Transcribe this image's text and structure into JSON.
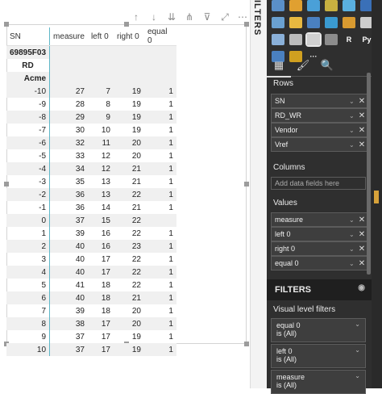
{
  "toolbar_icons": [
    "arrow-up-icon",
    "arrow-down-icon",
    "double-arrow-down-icon",
    "expand-hierarchy-icon",
    "filter-icon",
    "focus-mode-icon",
    "more-options-icon"
  ],
  "matrix": {
    "headers": [
      "SN",
      "measure",
      "left 0",
      "right 0",
      "equal 0"
    ],
    "hierarchy": [
      "69895F03",
      "RD",
      "Acme"
    ],
    "rows": [
      {
        "sn": "-10",
        "measure": "27",
        "left": "7",
        "right": "19",
        "equal": "1"
      },
      {
        "sn": "-9",
        "measure": "28",
        "left": "8",
        "right": "19",
        "equal": "1"
      },
      {
        "sn": "-8",
        "measure": "29",
        "left": "9",
        "right": "19",
        "equal": "1"
      },
      {
        "sn": "-7",
        "measure": "30",
        "left": "10",
        "right": "19",
        "equal": "1"
      },
      {
        "sn": "-6",
        "measure": "32",
        "left": "11",
        "right": "20",
        "equal": "1"
      },
      {
        "sn": "-5",
        "measure": "33",
        "left": "12",
        "right": "20",
        "equal": "1"
      },
      {
        "sn": "-4",
        "measure": "34",
        "left": "12",
        "right": "21",
        "equal": "1"
      },
      {
        "sn": "-3",
        "measure": "35",
        "left": "13",
        "right": "21",
        "equal": "1"
      },
      {
        "sn": "-2",
        "measure": "36",
        "left": "13",
        "right": "22",
        "equal": "1"
      },
      {
        "sn": "-1",
        "measure": "36",
        "left": "14",
        "right": "21",
        "equal": "1"
      },
      {
        "sn": "0",
        "measure": "37",
        "left": "15",
        "right": "22",
        "equal": ""
      },
      {
        "sn": "1",
        "measure": "39",
        "left": "16",
        "right": "22",
        "equal": "1"
      },
      {
        "sn": "2",
        "measure": "40",
        "left": "16",
        "right": "23",
        "equal": "1"
      },
      {
        "sn": "3",
        "measure": "40",
        "left": "17",
        "right": "22",
        "equal": "1"
      },
      {
        "sn": "4",
        "measure": "40",
        "left": "17",
        "right": "22",
        "equal": "1"
      },
      {
        "sn": "5",
        "measure": "41",
        "left": "18",
        "right": "22",
        "equal": "1"
      },
      {
        "sn": "6",
        "measure": "40",
        "left": "18",
        "right": "21",
        "equal": "1"
      },
      {
        "sn": "7",
        "measure": "39",
        "left": "18",
        "right": "20",
        "equal": "1"
      },
      {
        "sn": "8",
        "measure": "38",
        "left": "17",
        "right": "20",
        "equal": "1"
      },
      {
        "sn": "9",
        "measure": "37",
        "left": "17",
        "right": "19",
        "equal": "1"
      },
      {
        "sn": "10",
        "measure": "37",
        "left": "17",
        "right": "19",
        "equal": "1"
      }
    ]
  },
  "pane": {
    "strip_title": "ILTERS",
    "visual_icons": [
      {
        "name": "stacked-bar-icon",
        "color": "#5a8fc8",
        "glyph": ""
      },
      {
        "name": "line-column-icon",
        "color": "#e0a030",
        "glyph": ""
      },
      {
        "name": "ribbon-chart-icon",
        "color": "#4aa0d8",
        "glyph": ""
      },
      {
        "name": "waterfall-icon",
        "color": "#c8b040",
        "glyph": ""
      },
      {
        "name": "funnel-icon",
        "color": "#5ab0e0",
        "glyph": ""
      },
      {
        "name": "card-icon",
        "color": "#3a70b8",
        "glyph": ""
      },
      {
        "name": "scatter-icon",
        "color": "#6aa0d0",
        "glyph": ""
      },
      {
        "name": "pie-icon",
        "color": "#e8b840",
        "glyph": ""
      },
      {
        "name": "treemap-icon",
        "color": "#4a80c0",
        "glyph": ""
      },
      {
        "name": "map-icon",
        "color": "#3a9ad0",
        "glyph": ""
      },
      {
        "name": "gauge-icon",
        "color": "#d89a30",
        "glyph": ""
      },
      {
        "name": "kpi-icon",
        "color": "#cccccc",
        "glyph": ""
      },
      {
        "name": "slicer-icon",
        "color": "#8ab0d8",
        "glyph": ""
      },
      {
        "name": "table-icon",
        "color": "#bcbcbc",
        "glyph": ""
      },
      {
        "name": "matrix-icon",
        "color": "#d0d0d0",
        "glyph": ""
      },
      {
        "name": "shape-map-icon",
        "color": "#8c8c8c",
        "glyph": ""
      },
      {
        "name": "r-visual-icon",
        "color": "#2f2f2f",
        "glyph": "R"
      },
      {
        "name": "python-visual-icon",
        "color": "#2f2f2f",
        "glyph": "Py"
      },
      {
        "name": "arcgis-icon",
        "color": "#4a80c0",
        "glyph": ""
      },
      {
        "name": "globe-icon",
        "color": "#d0a020",
        "glyph": ""
      },
      {
        "name": "more-visuals-icon",
        "color": "#2f2f2f",
        "glyph": "···"
      }
    ],
    "tabs": [
      {
        "name": "fields-tab-icon",
        "glyph": "▦",
        "active": true
      },
      {
        "name": "format-tab-icon",
        "glyph": "🖌",
        "active": false
      },
      {
        "name": "analytics-tab-icon",
        "glyph": "🔍",
        "active": false
      }
    ],
    "rows_label": "Rows",
    "rows": [
      "SN",
      "RD_WR",
      "Vendor",
      "Vref"
    ],
    "columns_label": "Columns",
    "columns_placeholder": "Add data fields here",
    "values_label": "Values",
    "values": [
      "measure",
      "left 0",
      "right 0",
      "equal 0"
    ],
    "filters_title": "FILTERS",
    "visual_level_label": "Visual level filters",
    "filter_cards": [
      {
        "field": "equal 0",
        "state": "is (All)"
      },
      {
        "field": "left 0",
        "state": "is (All)"
      },
      {
        "field": "measure",
        "state": "is (All)"
      }
    ]
  }
}
